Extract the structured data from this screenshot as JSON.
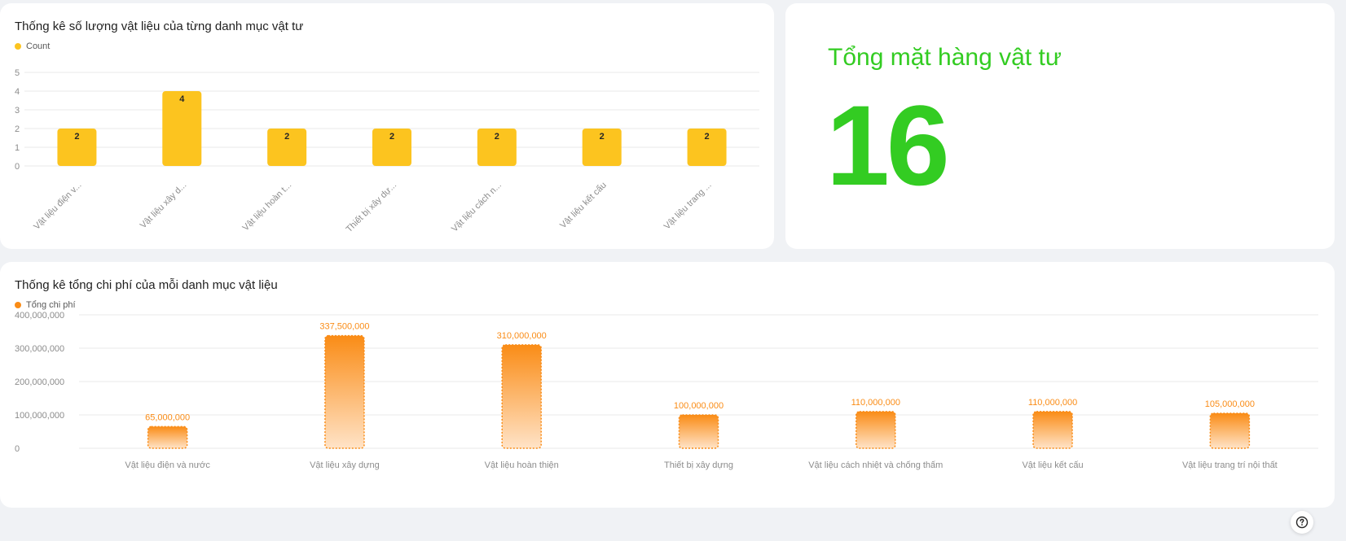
{
  "count_chart": {
    "title": "Thống kê số lượng vật liệu của từng danh mục vật tư",
    "legend_label": "Count",
    "legend_color": "#fcc41f"
  },
  "total_card": {
    "label": "Tổng mặt hàng vật tư",
    "value": "16",
    "color": "#33cc22"
  },
  "cost_chart": {
    "title": "Thống kê tổng chi phí của mỗi danh mục vật liệu",
    "legend_label": "Tổng chi phí",
    "legend_color": "#fa8c16"
  },
  "help_icon": "question-circle-icon",
  "chart_data": [
    {
      "type": "bar",
      "title": "Thống kê số lượng vật liệu của từng danh mục vật tư",
      "categories": [
        "Vật liệu điện v...",
        "Vật liệu xây d...",
        "Vật liệu hoàn t...",
        "Thiết bị xây dự...",
        "Vật liệu cách n...",
        "Vật liệu kết cấu",
        "Vật liệu trang ..."
      ],
      "series": [
        {
          "name": "Count",
          "values": [
            2,
            4,
            2,
            2,
            2,
            2,
            2
          ]
        }
      ],
      "ylim": [
        0,
        5
      ],
      "yticks": [
        "0",
        "1",
        "2",
        "3",
        "4",
        "5"
      ],
      "grid": true,
      "legend": "top-left"
    },
    {
      "type": "bar",
      "title": "Thống kê tổng chi phí của mỗi danh mục vật liệu",
      "categories": [
        "Vật liệu điện và nước",
        "Vật liệu xây dựng",
        "Vật liệu hoàn thiện",
        "Thiết bị xây dựng",
        "Vật liệu cách nhiệt và chống thấm",
        "Vật liệu kết cấu",
        "Vật liệu trang trí nội thất"
      ],
      "series": [
        {
          "name": "Tổng chi phí",
          "values": [
            65000000,
            337500000,
            310000000,
            100000000,
            110000000,
            110000000,
            105000000
          ]
        }
      ],
      "value_labels": [
        "65,000,000",
        "337,500,000",
        "310,000,000",
        "100,000,000",
        "110,000,000",
        "110,000,000",
        "105,000,000"
      ],
      "ylim": [
        0,
        400000000
      ],
      "yticks": [
        "0",
        "100,000,000",
        "200,000,000",
        "300,000,000",
        "400,000,000"
      ],
      "grid": true,
      "legend": "top-left"
    }
  ]
}
